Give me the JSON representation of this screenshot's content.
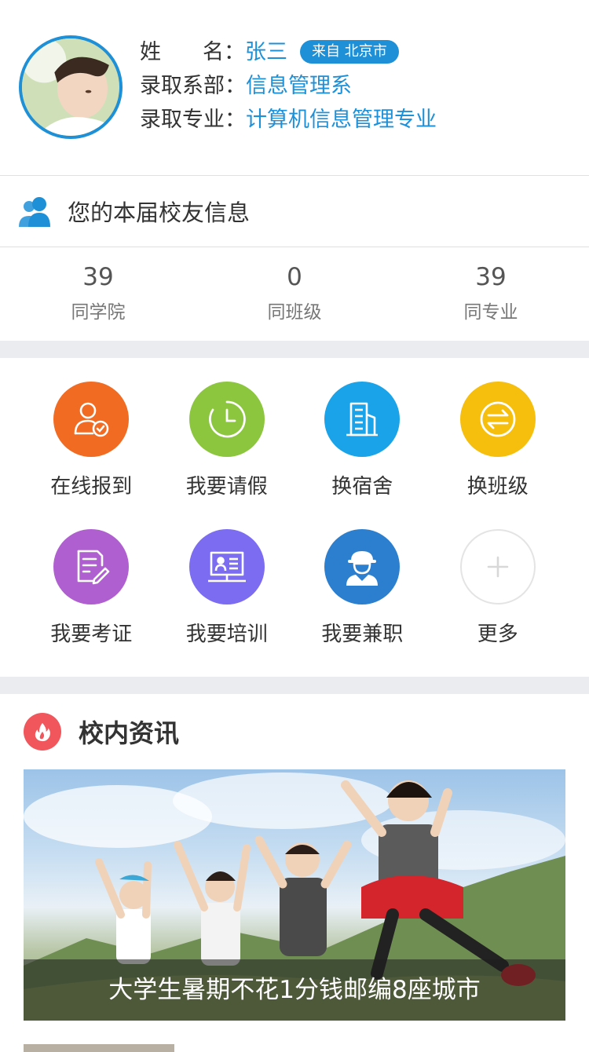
{
  "profile": {
    "name_label_a": "姓",
    "name_label_b": "名：",
    "name": "张三",
    "origin": "来自 北京市",
    "dept_label": "录取系部：",
    "dept": "信息管理系",
    "major_label": "录取专业：",
    "major": "计算机信息管理专业"
  },
  "alumni": {
    "title": "您的本届校友信息",
    "stats": [
      {
        "value": "39",
        "label": "同学院"
      },
      {
        "value": "0",
        "label": "同班级"
      },
      {
        "value": "39",
        "label": "同专业"
      }
    ]
  },
  "functions": [
    {
      "label": "在线报到",
      "color": "#f26b23",
      "icon": "user-check-icon"
    },
    {
      "label": "我要请假",
      "color": "#8cc63f",
      "icon": "clock-icon"
    },
    {
      "label": "换宿舍",
      "color": "#1aa3e8",
      "icon": "building-icon"
    },
    {
      "label": "换班级",
      "color": "#f6be0d",
      "icon": "swap-arrows-icon"
    },
    {
      "label": "我要考证",
      "color": "#b05fd1",
      "icon": "certificate-edit-icon"
    },
    {
      "label": "我要培训",
      "color": "#7b6cf2",
      "icon": "training-screen-icon"
    },
    {
      "label": "我要兼职",
      "color": "#2c7fcf",
      "icon": "worker-icon"
    },
    {
      "label": "更多",
      "color": "#dcdcdc",
      "icon": "plus-icon"
    }
  ],
  "news": {
    "title": "校内资讯",
    "items": [
      {
        "caption": "大学生暑期不花1分钱邮编8座城市"
      }
    ]
  }
}
